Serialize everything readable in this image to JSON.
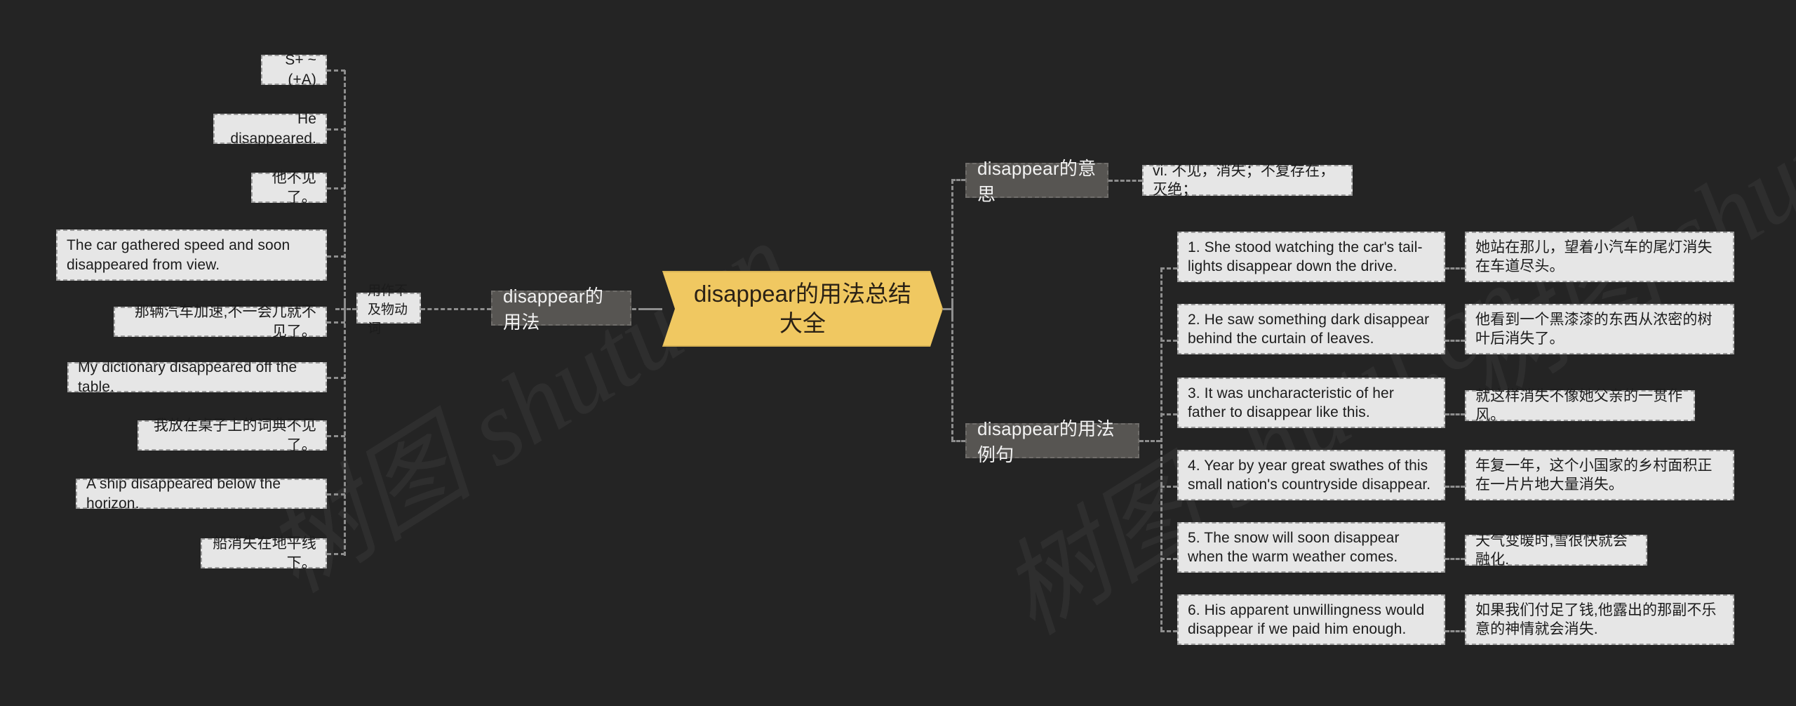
{
  "diagram": {
    "type": "mindmap",
    "background_color": "#242424",
    "center_node_color": "#f0c861",
    "branch_node_color": "#575552",
    "leaf_node_color": "#e6e6e6",
    "connector_color": "#8e8e8e",
    "title": "disappear的用法总结大全"
  },
  "watermark": {
    "text_a": "树图 shutu.cn",
    "text_b": "树图 shutu.cn",
    "text_c": "树图 shutu.cn"
  },
  "center": {
    "label": "disappear的用法总结大全"
  },
  "branches": {
    "usage": {
      "label": "disappear的用法",
      "subbranch": {
        "label": "用作不及物动词"
      },
      "leaves": [
        {
          "label": "S+ ~ (+A)"
        },
        {
          "label": "He disappeared."
        },
        {
          "label": "他不见了。"
        },
        {
          "label": "The car gathered speed and soon disappeared from view."
        },
        {
          "label": "那辆汽车加速,不一会儿就不见了。"
        },
        {
          "label": "My dictionary disappeared off the table."
        },
        {
          "label": "我放在桌子上的词典不见了。"
        },
        {
          "label": "A ship disappeared below the horizon."
        },
        {
          "label": "船消失在地平线下。"
        }
      ]
    },
    "meaning": {
      "label": "disappear的意思",
      "definition": "vi. 不见，消失；不复存在，灭绝；"
    },
    "examples": {
      "label": "disappear的用法例句",
      "items": [
        {
          "english": "1. She stood watching the car's tail-lights disappear down the drive.",
          "chinese": "她站在那儿，望着小汽车的尾灯消失在车道尽头。"
        },
        {
          "english": "2. He saw something dark disappear behind the curtain of leaves.",
          "chinese": "他看到一个黑漆漆的东西从浓密的树叶后消失了。"
        },
        {
          "english": "3. It was uncharacteristic of her father to disappear like this.",
          "chinese": "就这样消失不像她父亲的一贯作风。"
        },
        {
          "english": "4. Year by year great swathes of this small nation's countryside disappear.",
          "chinese": "年复一年，这个小国家的乡村面积正在一片片地大量消失。"
        },
        {
          "english": "5. The snow will soon disappear when the warm weather comes.",
          "chinese": "天气变暖时,雪很快就会融化."
        },
        {
          "english": "6. His apparent unwillingness would disappear if we paid him enough.",
          "chinese": "如果我们付足了钱,他露出的那副不乐意的神情就会消失."
        }
      ]
    }
  }
}
